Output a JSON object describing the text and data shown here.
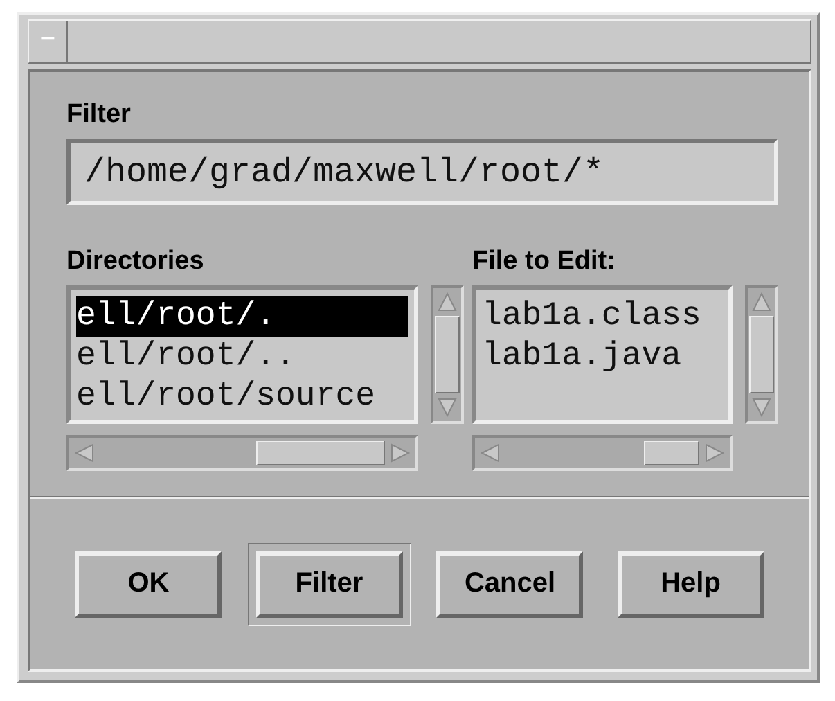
{
  "window": {
    "menu_button": "‒"
  },
  "filter": {
    "label": "Filter",
    "value": "/home/grad/maxwell/root/*"
  },
  "directories": {
    "label": "Directories",
    "items": [
      {
        "text": "ell/root/.",
        "selected": true
      },
      {
        "text": "ell/root/..",
        "selected": false
      },
      {
        "text": "ell/root/source",
        "selected": false
      }
    ]
  },
  "files": {
    "label": "File to Edit:",
    "items": [
      {
        "text": "lab1a.class",
        "selected": false
      },
      {
        "text": "lab1a.java",
        "selected": false
      }
    ]
  },
  "buttons": [
    {
      "label": "OK",
      "default": false
    },
    {
      "label": "Filter",
      "default": true
    },
    {
      "label": "Cancel",
      "default": false
    },
    {
      "label": "Help",
      "default": false
    }
  ]
}
